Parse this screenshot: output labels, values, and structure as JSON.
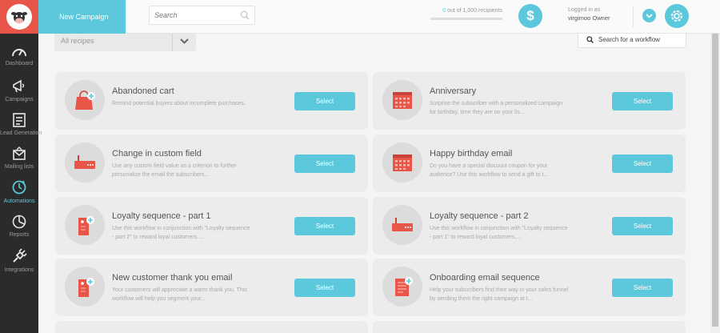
{
  "sidebar": {
    "items": [
      {
        "label": "Dashboard",
        "icon": "speedometer-icon"
      },
      {
        "label": "Campaigns",
        "icon": "megaphone-icon"
      },
      {
        "label": "Lead Generation",
        "icon": "form-icon"
      },
      {
        "label": "Mailing lists",
        "icon": "envelope-icon"
      },
      {
        "label": "Automations",
        "icon": "clock-refresh-icon"
      },
      {
        "label": "Reports",
        "icon": "pie-chart-icon"
      },
      {
        "label": "Integrations",
        "icon": "plug-icon"
      }
    ]
  },
  "header": {
    "new_campaign": "New Campaign",
    "search_placeholder": "Search",
    "recipients_count": "0",
    "recipients_text": "out of 1,000 recipients",
    "logged_in_as": "Logged in as",
    "user": "virgimoo Owner"
  },
  "filter": {
    "selected": "All recipes"
  },
  "workflow_search": {
    "placeholder": "Search for a workflow"
  },
  "cards": [
    {
      "title": "Abandoned cart",
      "desc": "Remind potential buyers about incomplete purchases.",
      "button": "Select",
      "icon": "shopping-bag-icon"
    },
    {
      "title": "Anniversary",
      "desc": "Surprise the subscriber with a personalized campaign for birthday, time they are on your lis...",
      "button": "Select",
      "icon": "calendar-icon"
    },
    {
      "title": "Change in custom field",
      "desc": "Use any custom field value as a criterion to further personalize the email the subscribers...",
      "button": "Select",
      "icon": "router-icon"
    },
    {
      "title": "Happy birthday email",
      "desc": "Do you have a special discount coupon for your audience? Use this workflow to send a gift to t...",
      "button": "Select",
      "icon": "calendar-icon"
    },
    {
      "title": "Loyalty sequence - part 1",
      "desc": "Use this workflow in conjunction with \"Loyalty sequence - part 2\" to reward loyal customers....",
      "button": "Select",
      "icon": "tag-icon"
    },
    {
      "title": "Loyalty sequence - part 2",
      "desc": "Use this workflow in conjunction with \"Loyalty sequence - part 1\" to reward loyal customers,...",
      "button": "Select",
      "icon": "router-icon"
    },
    {
      "title": "New customer thank you email",
      "desc": "Your customers will appreciate a warm thank you. This workflow will help you segment your...",
      "button": "Select",
      "icon": "tag-icon"
    },
    {
      "title": "Onboarding email sequence",
      "desc": "Help your subscribers find their way in your sales funnel by sending them the right campaign at t...",
      "button": "Select",
      "icon": "document-icon"
    }
  ],
  "colors": {
    "accent": "#5bc8dc",
    "logo": "#e8564a",
    "sidebar": "#2b2b2b",
    "icon_red": "#e8564a"
  }
}
